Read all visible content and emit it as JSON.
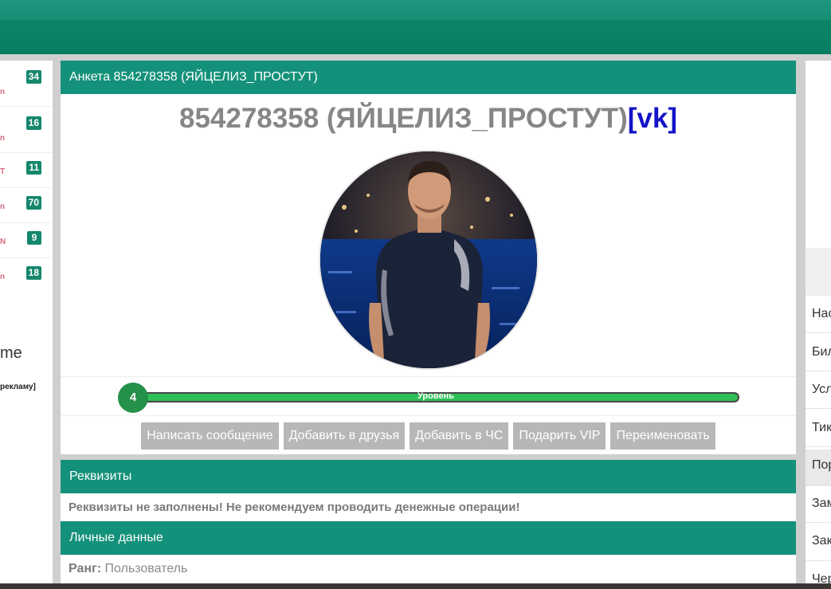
{
  "left_sidebar": {
    "items": [
      {
        "fragment": "n",
        "count": "34"
      },
      {
        "fragment": "n",
        "count": "16"
      },
      {
        "fragment": "T",
        "count": "11"
      },
      {
        "fragment": "n",
        "count": "70"
      },
      {
        "fragment": "N",
        "count": "9"
      },
      {
        "fragment": "n",
        "count": "18"
      }
    ],
    "me_fragment": "me",
    "ad_fragment": "рекламу]"
  },
  "profile": {
    "panel_title": "Анкета 854278358 (ЯЙЦЕЛИЗ_ПРОСТУТ)",
    "name": "854278358 (ЯЙЦЕЛИЗ_ПРОСТУТ)",
    "vk_link": "[vk]",
    "level": "4",
    "level_label": "Уровень",
    "level_fill": 1.0,
    "buttons": [
      "Написать сообщение",
      "Добавить в друзья",
      "Добавить в ЧС",
      "Подарить VIP",
      "Переименовать"
    ]
  },
  "requisites": {
    "title": "Реквизиты",
    "notice": "Реквизиты не заполнены! Не рекомендуем проводить денежные операции!"
  },
  "personal": {
    "title": "Личные данные",
    "rank_label": "Ранг:",
    "rank_value": "Пользователь"
  },
  "right_sidebar": {
    "items": [
      "Нас",
      "Бил",
      "Усл",
      "Тик",
      "Пор",
      "Зам",
      "Зак",
      "Чер"
    ]
  },
  "colors": {
    "header_green": "#14917a",
    "badge_green": "#15876c",
    "level_green": "#2fbf57",
    "vk_blue": "#1414c8",
    "button_grey": "#b7b7b7"
  }
}
